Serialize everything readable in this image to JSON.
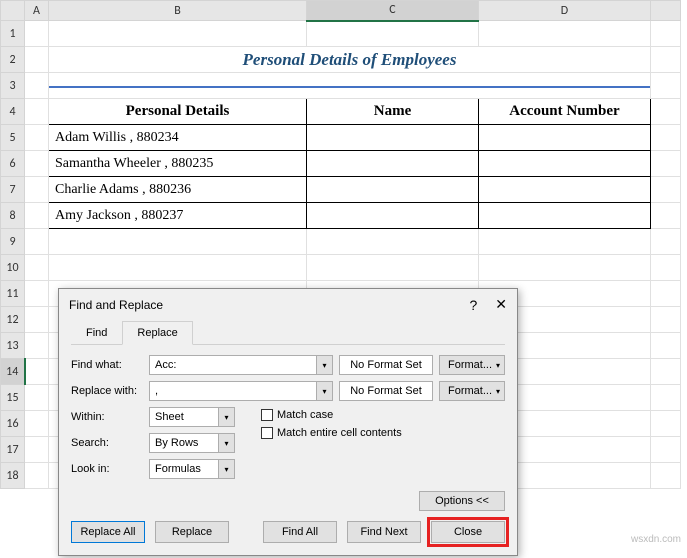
{
  "columns": [
    "",
    "A",
    "B",
    "C",
    "D",
    ""
  ],
  "rows": [
    "1",
    "2",
    "3",
    "4",
    "5",
    "6",
    "7",
    "8",
    "9",
    "10",
    "11",
    "12",
    "13",
    "14",
    "15",
    "16",
    "17",
    "18"
  ],
  "title": "Personal Details of Employees",
  "headers": {
    "b": "Personal Details",
    "c": "Name",
    "d": "Account Number"
  },
  "data": [
    {
      "b": "Adam Willis , 880234",
      "c": "",
      "d": ""
    },
    {
      "b": "Samantha Wheeler , 880235",
      "c": "",
      "d": ""
    },
    {
      "b": "Charlie Adams , 880236",
      "c": "",
      "d": ""
    },
    {
      "b": "Amy Jackson , 880237",
      "c": "",
      "d": ""
    }
  ],
  "dialog": {
    "title": "Find and Replace",
    "tabs": {
      "find": "Find",
      "replace": "Replace"
    },
    "labels": {
      "find_what": "Find what:",
      "replace_with": "Replace with:",
      "within": "Within:",
      "search": "Search:",
      "look_in": "Look in:"
    },
    "values": {
      "find_what": "Acc:",
      "replace_with": ",",
      "within": "Sheet",
      "search": "By Rows",
      "look_in": "Formulas"
    },
    "format_text": "No Format Set",
    "format_btn": "Format...",
    "checks": {
      "match_case": "Match case",
      "match_entire": "Match entire cell contents"
    },
    "options_btn": "Options <<",
    "buttons": {
      "replace_all": "Replace All",
      "replace": "Replace",
      "find_all": "Find All",
      "find_next": "Find Next",
      "close": "Close"
    }
  },
  "watermark": "wsxdn.com"
}
